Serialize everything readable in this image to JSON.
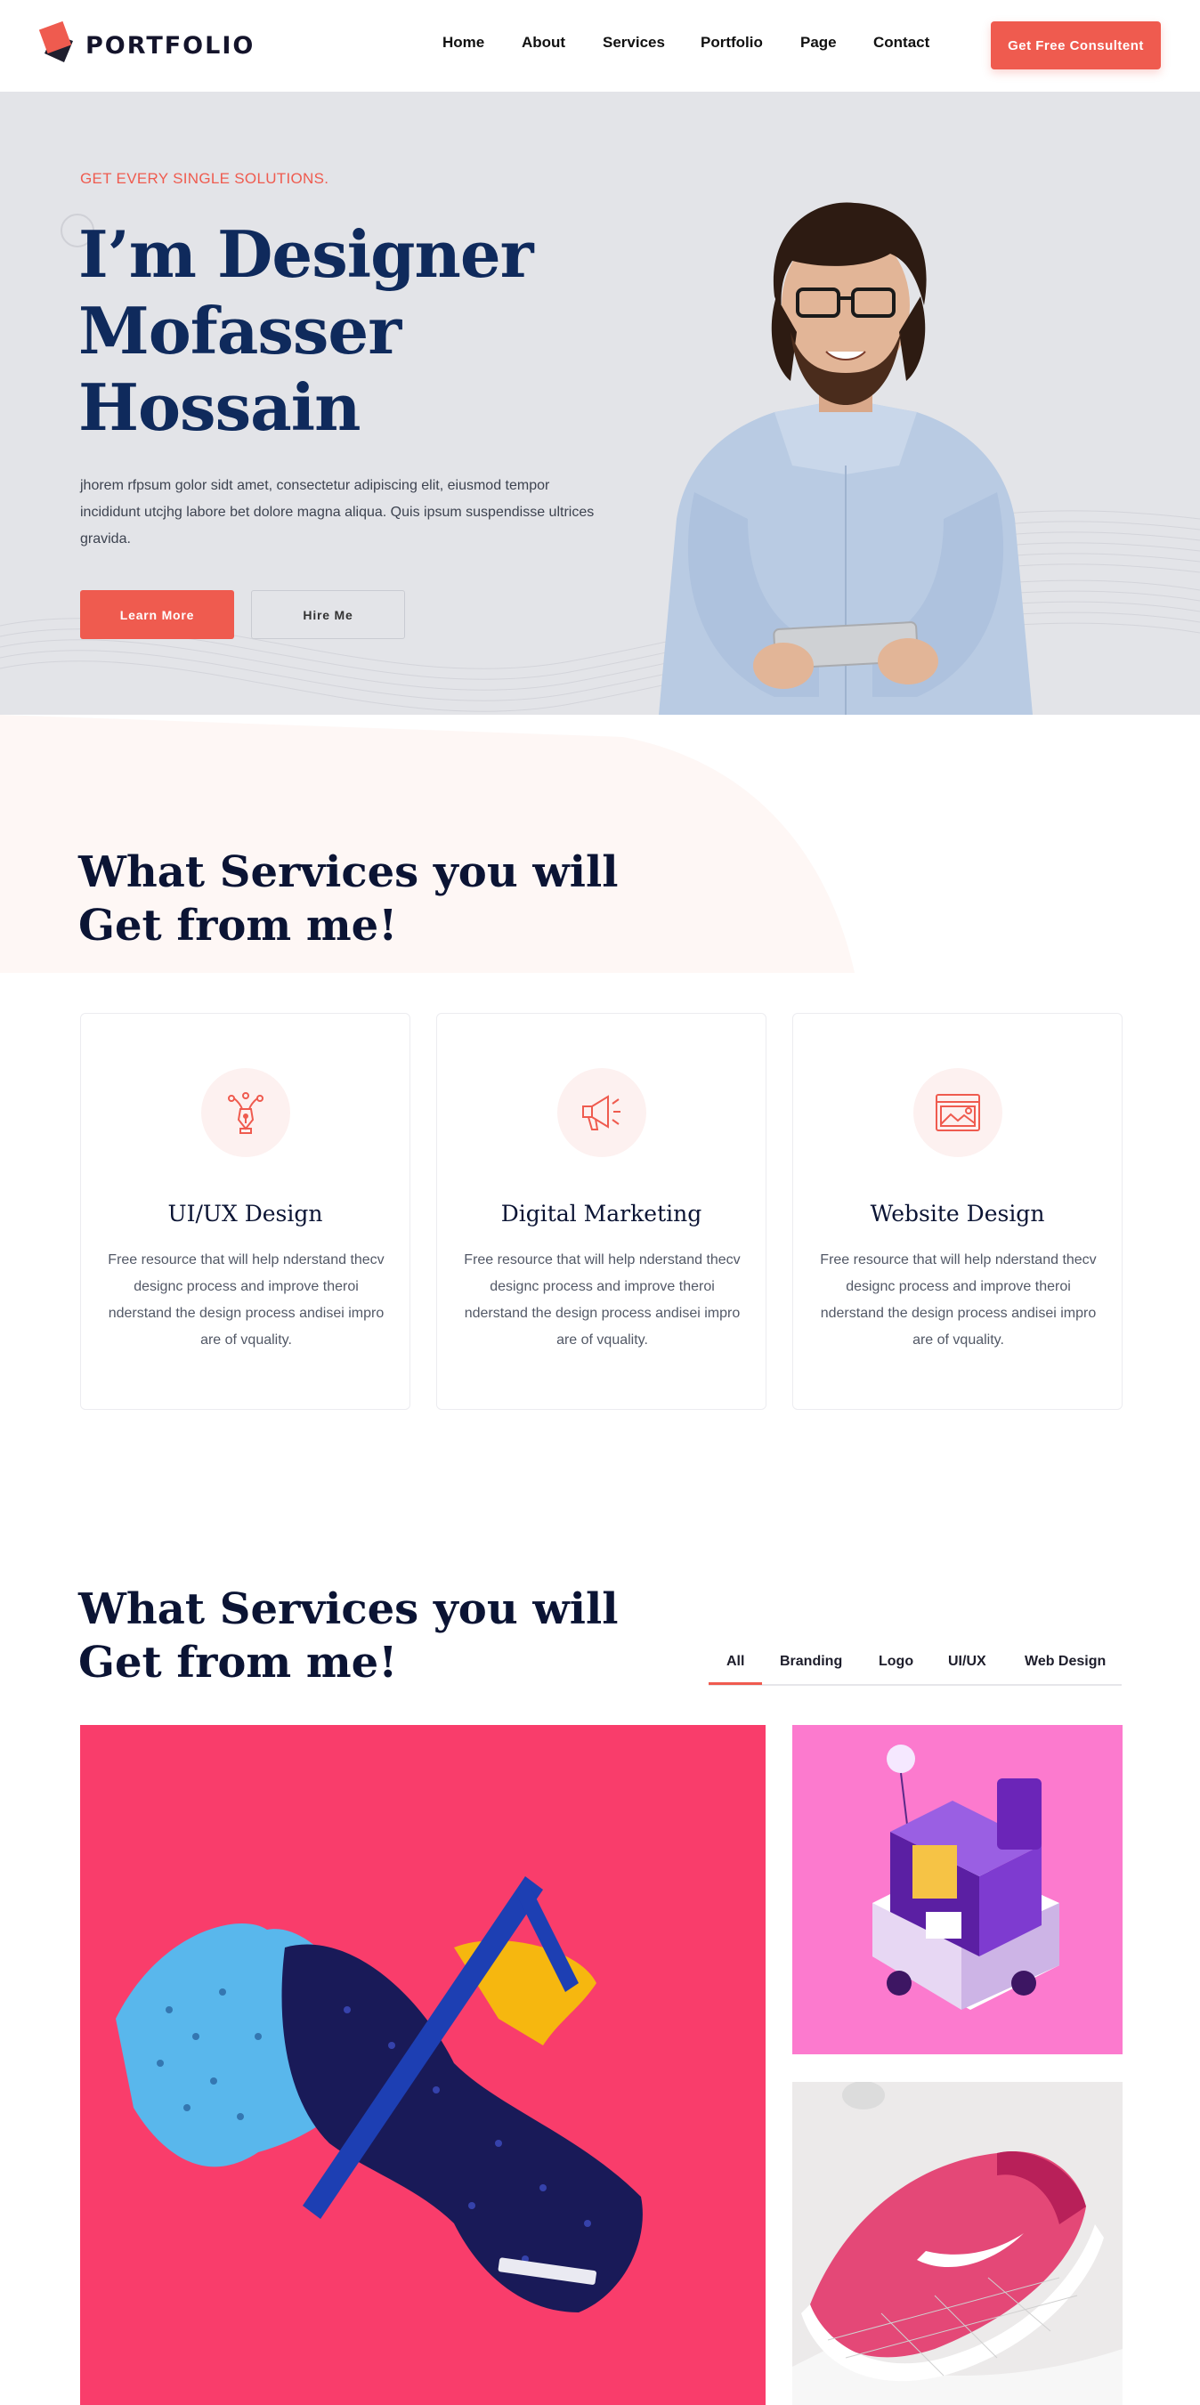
{
  "brand": {
    "name": "PORTFOLIO",
    "accent": "#ef5b4f",
    "dark": "#0b1434"
  },
  "nav": {
    "items": [
      "Home",
      "About",
      "Services",
      "Portfolio",
      "Page",
      "Contact"
    ],
    "cta": "Get Free Consultent"
  },
  "hero": {
    "tagline": "GET EVERY SINGLE SOLUTIONS.",
    "title_lines": [
      "I’m Designer",
      "Mofasser",
      "Hossain"
    ],
    "description": "jhorem rfpsum golor sidt amet, consectetur adipiscing elit, eiusmod tempor incididunt utcjhg labore bet dolore magna aliqua. Quis ipsum suspendisse ultrices gravida.",
    "primary_button": "Learn More",
    "secondary_button": "Hire Me"
  },
  "services": {
    "title_lines": [
      "What Services you will",
      "Get from me!"
    ],
    "cards": [
      {
        "icon": "pen-tool-icon",
        "title": "UI/UX Design",
        "description": "Free resource that will help nderstand thecv designc process and improve theroi nderstand the design process andisei impro are of vquality."
      },
      {
        "icon": "megaphone-icon",
        "title": "Digital Marketing",
        "description": "Free resource that will help nderstand thecv designc process and improve theroi nderstand the design process andisei impro are of vquality."
      },
      {
        "icon": "image-frame-icon",
        "title": "Website Design",
        "description": "Free resource that will help nderstand thecv designc process and improve theroi nderstand the design process andisei impro are of vquality."
      }
    ]
  },
  "portfolio": {
    "title_lines": [
      "What Services you will",
      "Get from me!"
    ],
    "tabs": [
      "All",
      "Branding",
      "Logo",
      "UI/UX",
      "Web Design"
    ],
    "active_tab": "All"
  }
}
